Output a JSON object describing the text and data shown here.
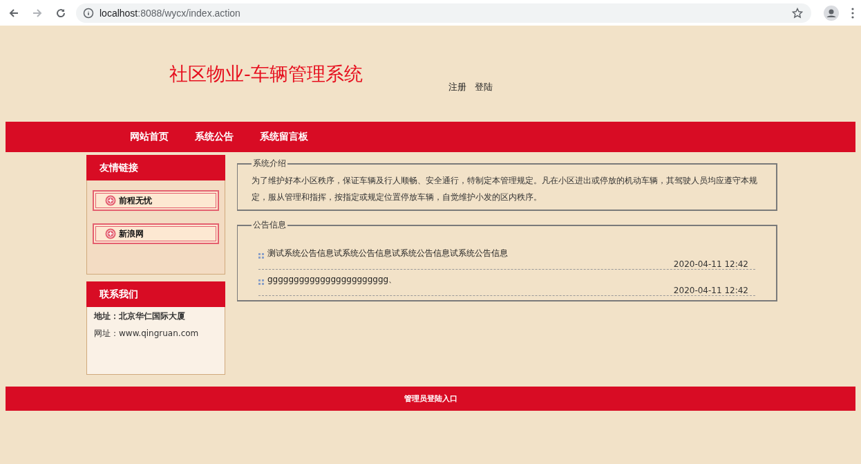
{
  "browser": {
    "url_host": "localhost",
    "url_rest": ":8088/wycx/index.action"
  },
  "header": {
    "title": "社区物业-车辆管理系统",
    "links": [
      "注册",
      "登陆"
    ]
  },
  "nav": {
    "items": [
      "网站首页",
      "系统公告",
      "系统留言板"
    ]
  },
  "friend_links": {
    "title": "友情链接",
    "items": [
      "前程无忧",
      "新浪网"
    ]
  },
  "contact": {
    "title": "联系我们",
    "lines": [
      {
        "text": "地址：北京华仁国际大厦",
        "bold": true
      },
      {
        "text": "网址：www.qingruan.com",
        "bold": false
      }
    ]
  },
  "intro": {
    "legend": "系统介绍",
    "text": "为了维护好本小区秩序，保证车辆及行人顺畅、安全通行，特制定本管理规定。凡在小区进出或停放的机动车辆，其驾驶人员均应遵守本规定，服从管理和指挥，按指定或规定位置停放车辆，自觉维护小发的区内秩序。"
  },
  "notices": {
    "legend": "公告信息",
    "items": [
      {
        "title": "测试系统公告信息试系统公告信息试系统公告信息试系统公告信息",
        "time": "2020-04-11 12:42"
      },
      {
        "title": "ggggggggggggggggggggggg、",
        "time": "2020-04-11 12:42"
      }
    ]
  },
  "footer": {
    "link": "管理员登陆入口"
  }
}
